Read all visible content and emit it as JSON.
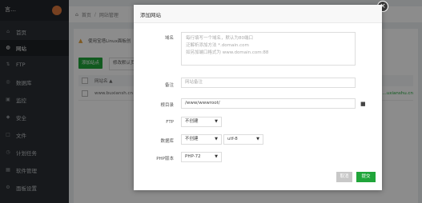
{
  "sidebar": {
    "user": "言…",
    "items": [
      {
        "label": "首页",
        "icon": "home-icon",
        "glyph": "⌂"
      },
      {
        "label": "网站",
        "icon": "globe-icon",
        "glyph": "◍"
      },
      {
        "label": "FTP",
        "icon": "ftp-icon",
        "glyph": "⇅"
      },
      {
        "label": "数据库",
        "icon": "database-icon",
        "glyph": "◎"
      },
      {
        "label": "监控",
        "icon": "monitor-icon",
        "glyph": "▣"
      },
      {
        "label": "安全",
        "icon": "shield-icon",
        "glyph": "◆"
      },
      {
        "label": "文件",
        "icon": "file-icon",
        "glyph": "□"
      },
      {
        "label": "计划任务",
        "icon": "clock-icon",
        "glyph": "◷"
      },
      {
        "label": "软件管理",
        "icon": "grid-icon",
        "glyph": "▦"
      },
      {
        "label": "面板设置",
        "icon": "gear-icon",
        "glyph": "⚙"
      }
    ]
  },
  "breadcrumb": {
    "home": "首页",
    "current": "网站管理"
  },
  "main": {
    "notice": "使用宝塔Linux面板创",
    "add_button": "添加站点",
    "default_button": "修改默认页",
    "column_site": "网站名 ▲",
    "row_site": "www.buxiansh.cn",
    "row_right": "...uxianshu.cn"
  },
  "modal": {
    "title": "添加网站",
    "domain_label": "域名",
    "domain_placeholder_lines": [
      "每行填写一个域名，默认为80端口",
      "泛解析添加方法 *.domain.com",
      "如另加端口格式为 www.domain.com:88"
    ],
    "remark_label": "备注",
    "remark_placeholder": "网站备注",
    "root_label": "根目录",
    "root_value": "/www/wwwroot/",
    "ftp_label": "FTP",
    "ftp_value": "不创建",
    "db_label": "数据库",
    "db_value": "不创建",
    "charset_value": "utf-8",
    "php_label": "PHP版本",
    "php_value": "PHP-72",
    "cancel": "取消",
    "submit": "提交",
    "close_glyph": "×"
  },
  "colors": {
    "accent": "#20a53a",
    "sidebar": "#2b2f33"
  }
}
